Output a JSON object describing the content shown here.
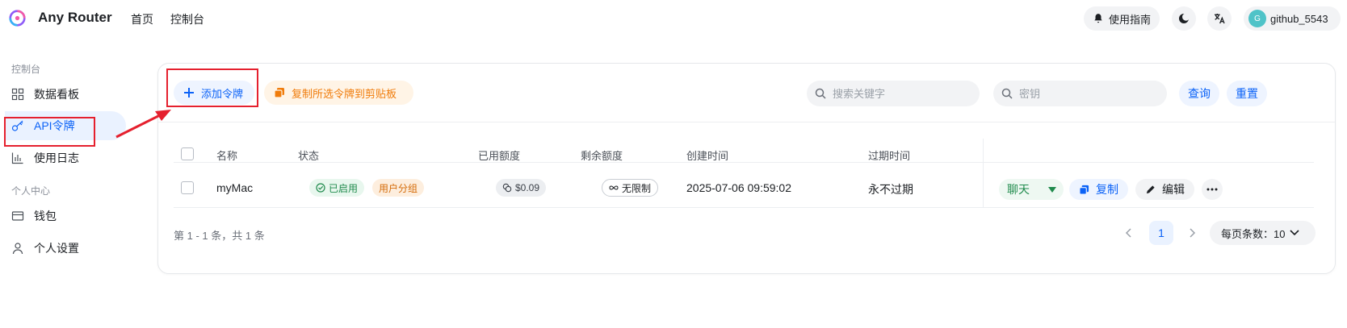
{
  "header": {
    "brand": "Any Router",
    "nav": [
      "首页",
      "控制台"
    ],
    "guide_label": "使用指南",
    "username": "github_5543",
    "avatar_letter": "G"
  },
  "sidebar": {
    "group1": "控制台",
    "group2": "个人中心",
    "items": [
      {
        "label": "数据看板",
        "icon": "dashboard-icon"
      },
      {
        "label": "API令牌",
        "icon": "key-icon",
        "active": true
      },
      {
        "label": "使用日志",
        "icon": "chart-icon"
      },
      {
        "label": "钱包",
        "icon": "wallet-icon"
      },
      {
        "label": "个人设置",
        "icon": "user-icon"
      }
    ]
  },
  "toolbar": {
    "add_label": "添加令牌",
    "copy_selected_label": "复制所选令牌到剪贴板",
    "search_placeholder": "搜索关键字",
    "secret_placeholder": "密钥",
    "query_label": "查询",
    "reset_label": "重置"
  },
  "table": {
    "headers": [
      "名称",
      "状态",
      "已用额度",
      "剩余额度",
      "创建时间",
      "过期时间"
    ],
    "rows": [
      {
        "name": "myMac",
        "status": "已启用",
        "group": "用户分组",
        "used": "$0.09",
        "remaining": "无限制",
        "created": "2025-07-06 09:59:02",
        "expires": "永不过期",
        "actions": {
          "chat": "聊天",
          "copy": "复制",
          "edit": "编辑"
        }
      }
    ]
  },
  "footer": {
    "summary": "第 1 - 1 条，共 1 条",
    "current_page": "1",
    "page_size_label": "每页条数：10"
  },
  "colors": {
    "primary": "#0b62f7",
    "warning": "#f07c0b",
    "success": "#1f8a4c",
    "annotation": "#e5202e"
  }
}
